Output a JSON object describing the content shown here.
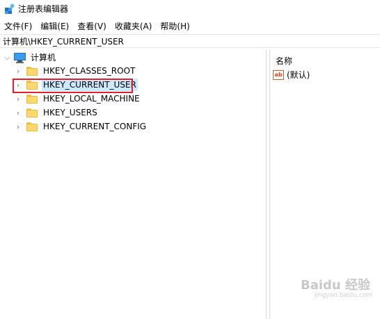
{
  "window": {
    "title": "注册表编辑器"
  },
  "menu": [
    {
      "label": "文件(F)"
    },
    {
      "label": "编辑(E)"
    },
    {
      "label": "查看(V)"
    },
    {
      "label": "收藏夹(A)"
    },
    {
      "label": "帮助(H)"
    }
  ],
  "address": {
    "path": "计算机\\HKEY_CURRENT_USER"
  },
  "tree": {
    "root": {
      "label": "计算机",
      "icon": "computer-icon",
      "expanded": true
    },
    "children": [
      {
        "label": "HKEY_CLASSES_ROOT",
        "icon": "folder-icon",
        "selected": false
      },
      {
        "label": "HKEY_CURRENT_USER",
        "icon": "folder-icon",
        "selected": true
      },
      {
        "label": "HKEY_LOCAL_MACHINE",
        "icon": "folder-icon",
        "selected": false
      },
      {
        "label": "HKEY_USERS",
        "icon": "folder-icon",
        "selected": false
      },
      {
        "label": "HKEY_CURRENT_CONFIG",
        "icon": "folder-icon",
        "selected": false
      }
    ]
  },
  "values_pane": {
    "column_header": "名称",
    "rows": [
      {
        "name": "(默认)",
        "icon": "string-value-icon",
        "icon_text": "ab"
      }
    ]
  },
  "watermark": {
    "text": "Baidu 经验",
    "sub": "jingyan.baidu.com"
  },
  "colors": {
    "selection": "#cce8ff",
    "highlight_box": "#e5202a",
    "folder": "#ffd970"
  }
}
